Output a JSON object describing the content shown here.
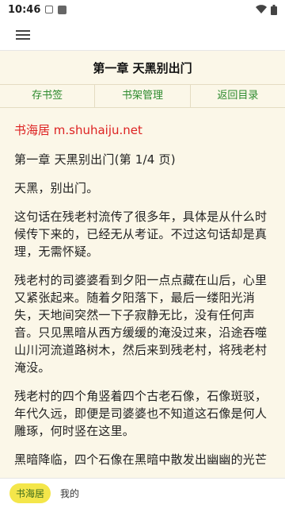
{
  "status": {
    "time": "10:46"
  },
  "chapter": {
    "title": "第一章 天黑别出门"
  },
  "nav": {
    "bookmark": "存书签",
    "shelf": "书架管理",
    "toc": "返回目录"
  },
  "content": {
    "site": "书海居 m.shuhaiju.net",
    "paragraphs": [
      "第一章 天黑别出门(第 1/4 页)",
      "天黑，别出门。",
      "这句话在残老村流传了很多年，具体是从什么时候传下来的，已经无从考证。不过这句话却是真理，无需怀疑。",
      "残老村的司婆婆看到夕阳一点点藏在山后，心里又紧张起来。随着夕阳落下，最后一缕阳光消失，天地间突然一下子寂静无比，没有任何声音。只见黑暗从西方缓缓的淹没过来，沿途吞噬山川河流道路树木，然后来到残老村，将残老村淹没。",
      "残老村的四个角竖着四个古老石像，石像斑驳，年代久远，即便是司婆婆也不知道这石像是何人雕琢，何时竖在这里。",
      "黑暗降临，四个石像在黑暗中散发出幽幽的光芒"
    ]
  },
  "bottom": {
    "tab_active": "书海居",
    "tab_mine": "我的"
  }
}
